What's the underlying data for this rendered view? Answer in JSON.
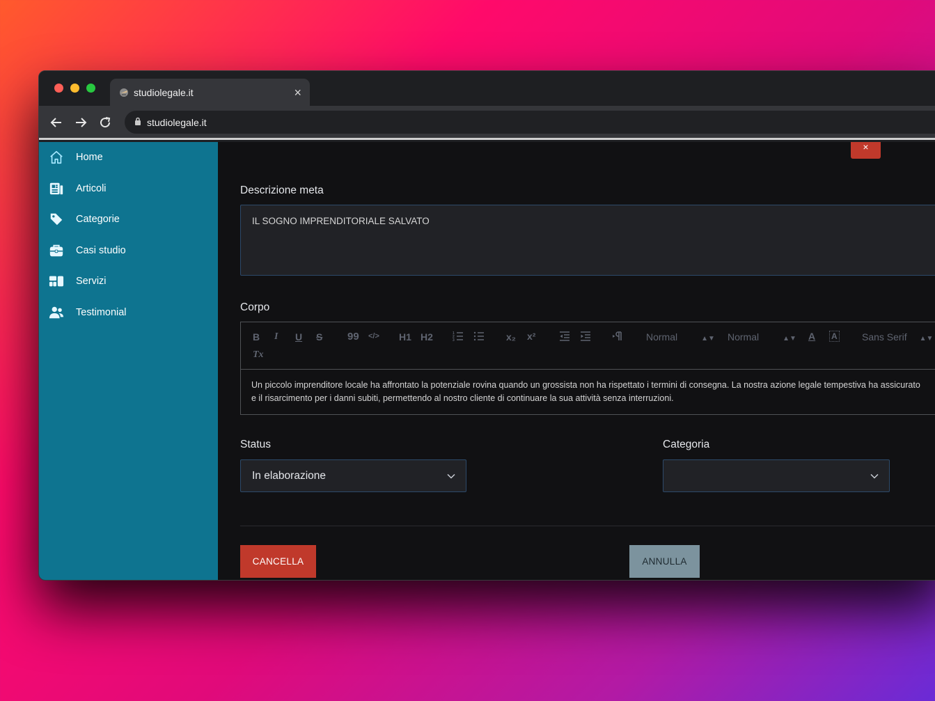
{
  "browser": {
    "tab_title": "studiolegale.it",
    "tab_close": "×",
    "url": "studiolegale.it"
  },
  "sidebar": {
    "items": [
      {
        "label": "Home",
        "icon": "home-icon"
      },
      {
        "label": "Articoli",
        "icon": "newspaper-icon"
      },
      {
        "label": "Categorie",
        "icon": "tag-icon"
      },
      {
        "label": "Casi studio",
        "icon": "briefcase-icon"
      },
      {
        "label": "Servizi",
        "icon": "services-icon"
      },
      {
        "label": "Testimonial",
        "icon": "users-icon"
      }
    ]
  },
  "form": {
    "close_label": "×",
    "meta_label": "Descrizione meta",
    "meta_value": "IL SOGNO IMPRENDITORIALE SALVATO",
    "body_label": "Corpo",
    "toolbar": {
      "bold": "B",
      "italic": "I",
      "underline": "U",
      "strike": "S",
      "quote": "99",
      "code": "</>",
      "h1": "H1",
      "h2": "H2",
      "subscript": "x₂",
      "superscript": "x²",
      "header_select": "Normal",
      "size_select": "Normal",
      "font_select": "Sans Serif",
      "font_color": "A",
      "background_color": "A",
      "clean": "Tx"
    },
    "body_line1": "Un piccolo imprenditore locale ha affrontato la potenziale rovina quando un grossista non ha rispettato i termini di consegna. La nostra azione legale tempestiva ha assicurato",
    "body_line2": "e il risarcimento per i danni subiti, permettendo al nostro cliente di continuare la sua attività senza interruzioni.",
    "status_label": "Status",
    "status_value": "In elaborazione",
    "category_label": "Categoria",
    "category_value": "",
    "delete_button": "CANCELLA",
    "cancel_button": "ANNULLA"
  },
  "colors": {
    "sidebar_bg": "#0e7490",
    "danger": "#c0392b",
    "secondary": "#7c939e"
  }
}
